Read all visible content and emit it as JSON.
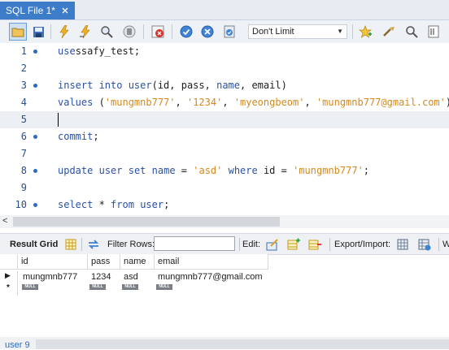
{
  "tab": {
    "title": "SQL File 1*",
    "close": "×"
  },
  "toolbar": {
    "icons": [
      "open-folder-icon",
      "save-icon",
      "execute-icon",
      "execute-current-icon",
      "explain-icon",
      "stop-icon",
      "toggle-error-icon",
      "commit-icon",
      "rollback-icon",
      "autocommit-icon",
      "add-snippet-icon",
      "beautify-icon",
      "find-icon",
      "wrap-icon"
    ],
    "limit_label": "Don't Limit"
  },
  "editor": {
    "lines": [
      {
        "num": "1",
        "dot": true,
        "tokens": [
          [
            "kw",
            "use"
          ],
          [
            "",
            "ssafy_test;"
          ]
        ]
      },
      {
        "num": "2",
        "dot": false,
        "tokens": []
      },
      {
        "num": "3",
        "dot": true,
        "tokens": [
          [
            "kw",
            "insert into"
          ],
          [
            "",
            ""
          ],
          [
            "kw",
            "user"
          ],
          [
            "",
            "(id, pass, "
          ],
          [
            "kw",
            "name"
          ],
          [
            "",
            ", email)"
          ]
        ]
      },
      {
        "num": "4",
        "dot": false,
        "tokens": [
          [
            "kw",
            "values"
          ],
          [
            "",
            " ("
          ],
          [
            "str",
            "'mungmnb777'"
          ],
          [
            "",
            ", "
          ],
          [
            "str",
            "'1234'"
          ],
          [
            "",
            ", "
          ],
          [
            "str",
            "'myeongbeom'"
          ],
          [
            "",
            ", "
          ],
          [
            "str",
            "'mungmnb777@gmail.com'"
          ],
          [
            "",
            ");"
          ]
        ]
      },
      {
        "num": "5",
        "dot": false,
        "tokens": [],
        "current": true
      },
      {
        "num": "6",
        "dot": true,
        "tokens": [
          [
            "kw",
            "commit"
          ],
          [
            "",
            ";"
          ]
        ]
      },
      {
        "num": "7",
        "dot": false,
        "tokens": []
      },
      {
        "num": "8",
        "dot": true,
        "tokens": [
          [
            "kw",
            "update"
          ],
          [
            "",
            " "
          ],
          [
            "kw",
            "user"
          ],
          [
            "",
            " "
          ],
          [
            "kw",
            "set"
          ],
          [
            "",
            " "
          ],
          [
            "kw",
            "name"
          ],
          [
            "",
            " = "
          ],
          [
            "str",
            "'asd'"
          ],
          [
            "",
            " "
          ],
          [
            "kw",
            "where"
          ],
          [
            "",
            " id = "
          ],
          [
            "str",
            "'mungmnb777'"
          ],
          [
            "",
            ";"
          ]
        ]
      },
      {
        "num": "9",
        "dot": false,
        "tokens": []
      },
      {
        "num": "10",
        "dot": true,
        "tokens": [
          [
            "kw",
            "select"
          ],
          [
            "",
            " * "
          ],
          [
            "kw",
            "from"
          ],
          [
            "",
            " "
          ],
          [
            "kw",
            "user"
          ],
          [
            "",
            ";"
          ]
        ]
      }
    ]
  },
  "result_toolbar": {
    "result_grid": "Result Grid",
    "filter_rows": "Filter Rows:",
    "filter_value": "",
    "edit": "Edit:",
    "export_import": "Export/Import:",
    "wrap": "W"
  },
  "grid": {
    "columns": [
      "id",
      "pass",
      "name",
      "email"
    ],
    "rows": [
      [
        "mungmnb777",
        "1234",
        "asd",
        "mungmnb777@gmail.com"
      ]
    ],
    "null_label": "NULL",
    "new_row_marker": "*",
    "current_row_marker": "▶"
  },
  "bottom": {
    "tab": "user 9"
  },
  "colors": {
    "accent": "#3d7cc9",
    "keyword": "#2a50a8",
    "string": "#d58a1e",
    "line_number": "#2a4f8c"
  }
}
